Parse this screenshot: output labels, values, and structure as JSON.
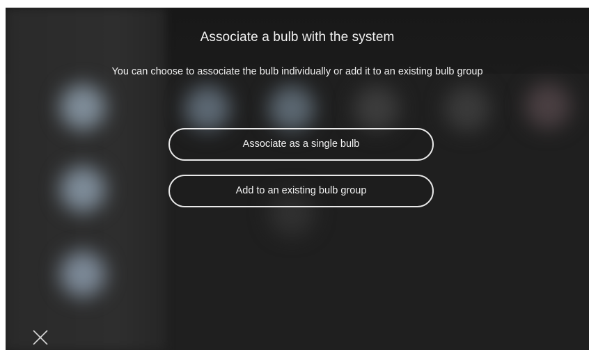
{
  "dialog": {
    "title": "Associate a bulb with the system",
    "description": "You can choose to associate the bulb individually or add it to an existing bulb group",
    "options": [
      {
        "label": "Associate as a single bulb"
      },
      {
        "label": "Add to an existing bulb group"
      }
    ]
  },
  "icons": {
    "close": "close-icon"
  },
  "colors": {
    "background": "#1f1f1f",
    "text": "#f2f2f2",
    "button_border": "#e9e9e9"
  }
}
